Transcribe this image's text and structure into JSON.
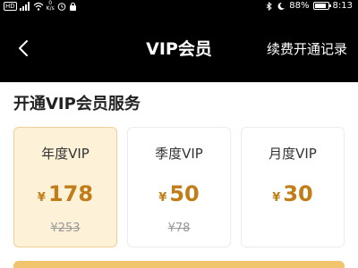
{
  "status_bar": {
    "hd": "HD",
    "signal_bars": "⁴⁶",
    "net_speed_value": "0",
    "net_speed_unit": "K/s",
    "battery_percent": "88%",
    "time": "8:13",
    "battery_level": 0.88
  },
  "header": {
    "title": "VIP会员",
    "record_link": "续费开通记录"
  },
  "section": {
    "title": "开通VIP会员服务"
  },
  "plans": [
    {
      "name": "年度VIP",
      "currency": "¥",
      "price": "178",
      "original": "¥253",
      "selected": true
    },
    {
      "name": "季度VIP",
      "currency": "¥",
      "price": "50",
      "original": "¥78",
      "selected": false
    },
    {
      "name": "月度VIP",
      "currency": "¥",
      "price": "30",
      "original": "",
      "selected": false
    }
  ],
  "colors": {
    "accent": "#c07d18",
    "selected_bg": "#fdf1d8",
    "bottom_bar": "#f2c46e"
  }
}
